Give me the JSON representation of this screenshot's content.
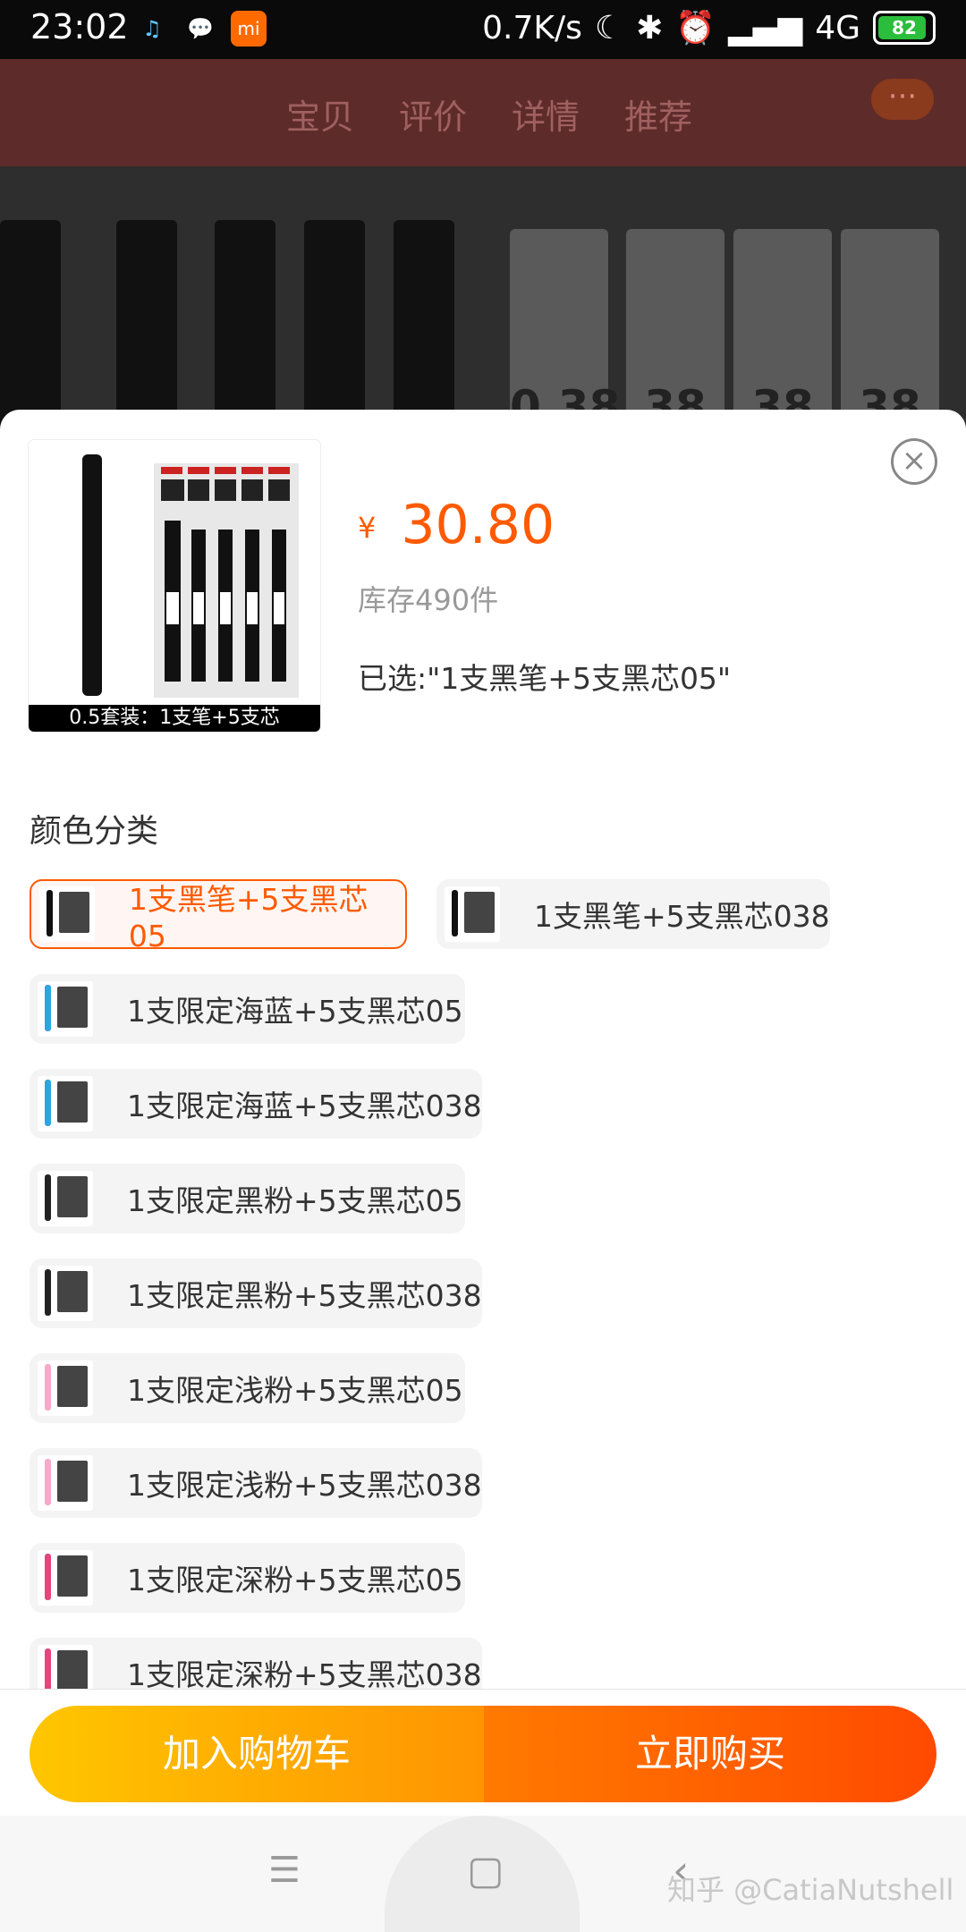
{
  "status_bar": {
    "time": "23:02",
    "net_speed": "0.7K/s",
    "network": "4G",
    "battery": "82",
    "icons": [
      "bluetooth-icon",
      "moon-icon",
      "alarm-icon",
      "signal-icon"
    ]
  },
  "background": {
    "tabs": [
      "宝贝",
      "评价",
      "详情",
      "推荐"
    ],
    "more": "···"
  },
  "product": {
    "thumb_caption": "0.5套装：1支笔+5支芯",
    "currency": "¥",
    "price": "30.80",
    "stock": "库存490件",
    "selected": "已选:\"1支黑笔+5支黑芯05\""
  },
  "section": {
    "title": "颜色分类"
  },
  "options": [
    {
      "label": "1支黑笔+5支黑芯05",
      "pen_color": "#111111"
    },
    {
      "label": "1支黑笔+5支黑芯038",
      "pen_color": "#111111"
    },
    {
      "label": "1支限定海蓝+5支黑芯05",
      "pen_color": "#2aa6e0"
    },
    {
      "label": "1支限定海蓝+5支黑芯038",
      "pen_color": "#2aa6e0"
    },
    {
      "label": "1支限定黑粉+5支黑芯05",
      "pen_color": "#222222"
    },
    {
      "label": "1支限定黑粉+5支黑芯038",
      "pen_color": "#222222"
    },
    {
      "label": "1支限定浅粉+5支黑芯05",
      "pen_color": "#f6a9c8"
    },
    {
      "label": "1支限定浅粉+5支黑芯038",
      "pen_color": "#f6a9c8"
    },
    {
      "label": "1支限定深粉+5支黑芯05",
      "pen_color": "#e8437d"
    },
    {
      "label": "1支限定深粉+5支黑芯038",
      "pen_color": "#e8437d"
    }
  ],
  "actions": {
    "add_to_cart": "加入购物车",
    "buy_now": "立即购买"
  },
  "nav": {
    "watermark": "知乎 @CatiaNutshell"
  },
  "colors": {
    "accent": "#ff5a00",
    "cart_gradient": [
      "#ffc600",
      "#ff9402"
    ],
    "buy_gradient": [
      "#ff7a00",
      "#ff4a00"
    ]
  }
}
